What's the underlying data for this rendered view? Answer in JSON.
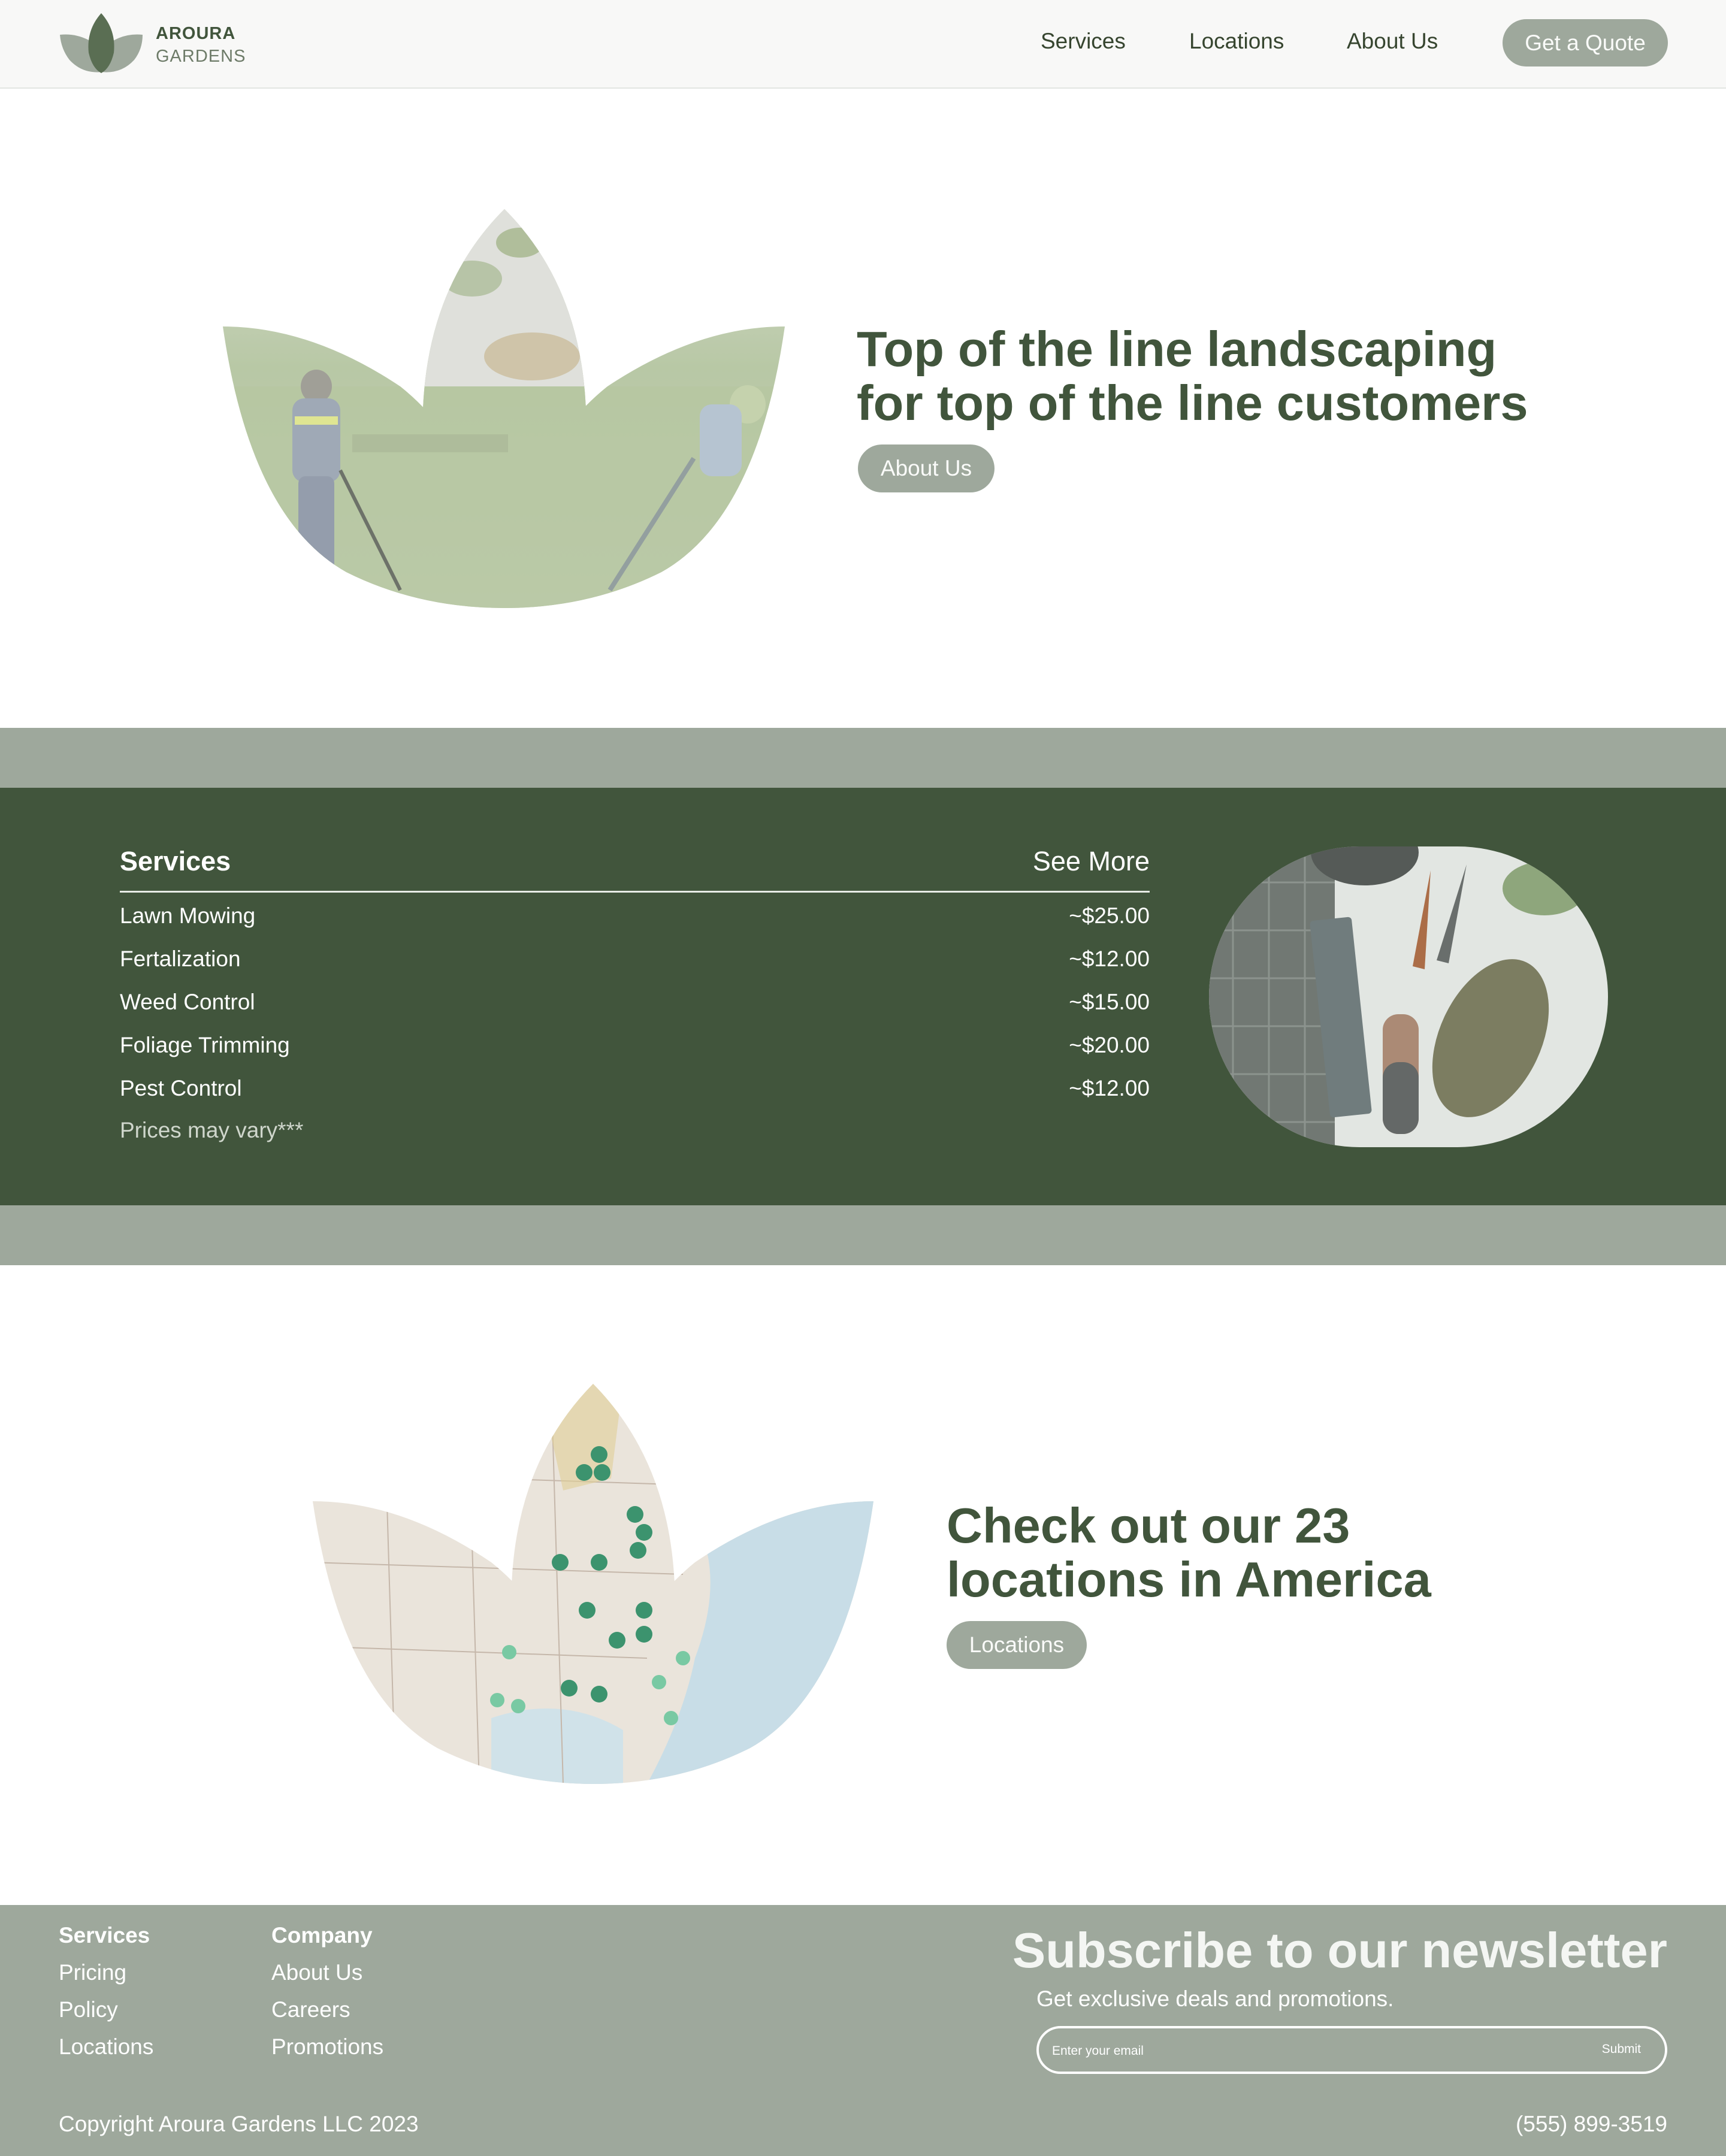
{
  "brand": {
    "name": "AROURA",
    "sub": "GARDENS",
    "icon": "lotus-leaf-logo"
  },
  "nav": {
    "items": [
      "Services",
      "Locations",
      "About Us"
    ],
    "cta": "Get a Quote"
  },
  "hero": {
    "title_line1": "Top of the line landscaping",
    "title_line2": "for top of the line customers",
    "button": "About Us",
    "image": "landscapers-mowing-lawn-photo"
  },
  "services": {
    "heading": "Services",
    "see_more": "See More",
    "items": [
      {
        "name": "Lawn Mowing",
        "price": "~$25.00"
      },
      {
        "name": "Fertalization",
        "price": "~$12.00"
      },
      {
        "name": "Weed Control",
        "price": "~$15.00"
      },
      {
        "name": "Foliage Trimming",
        "price": "~$20.00"
      },
      {
        "name": "Pest Control",
        "price": "~$12.00"
      }
    ],
    "note": "Prices may vary***",
    "image": "garden-tools-photo"
  },
  "locations": {
    "title_line1": "Check out our 23",
    "title_line2": "locations in America",
    "button": "Locations",
    "image": "usa-map-with-pins-photo"
  },
  "footer": {
    "col1": {
      "heading": "Services",
      "links": [
        "Pricing",
        "Policy",
        "Locations"
      ]
    },
    "col2": {
      "heading": "Company",
      "links": [
        "About Us",
        "Careers",
        "Promotions"
      ]
    },
    "newsletter": {
      "title": "Subscribe to our newsletter",
      "subtitle": "Get exclusive deals and promotions.",
      "placeholder": "Enter your email",
      "submit": "Submit"
    },
    "copyright": "Copyright Aroura Gardens LLC 2023",
    "phone": "(555) 899-3519"
  },
  "colors": {
    "dark_green": "#41553c",
    "sage": "#9ea89c",
    "header_bg": "#f8f8f7"
  }
}
